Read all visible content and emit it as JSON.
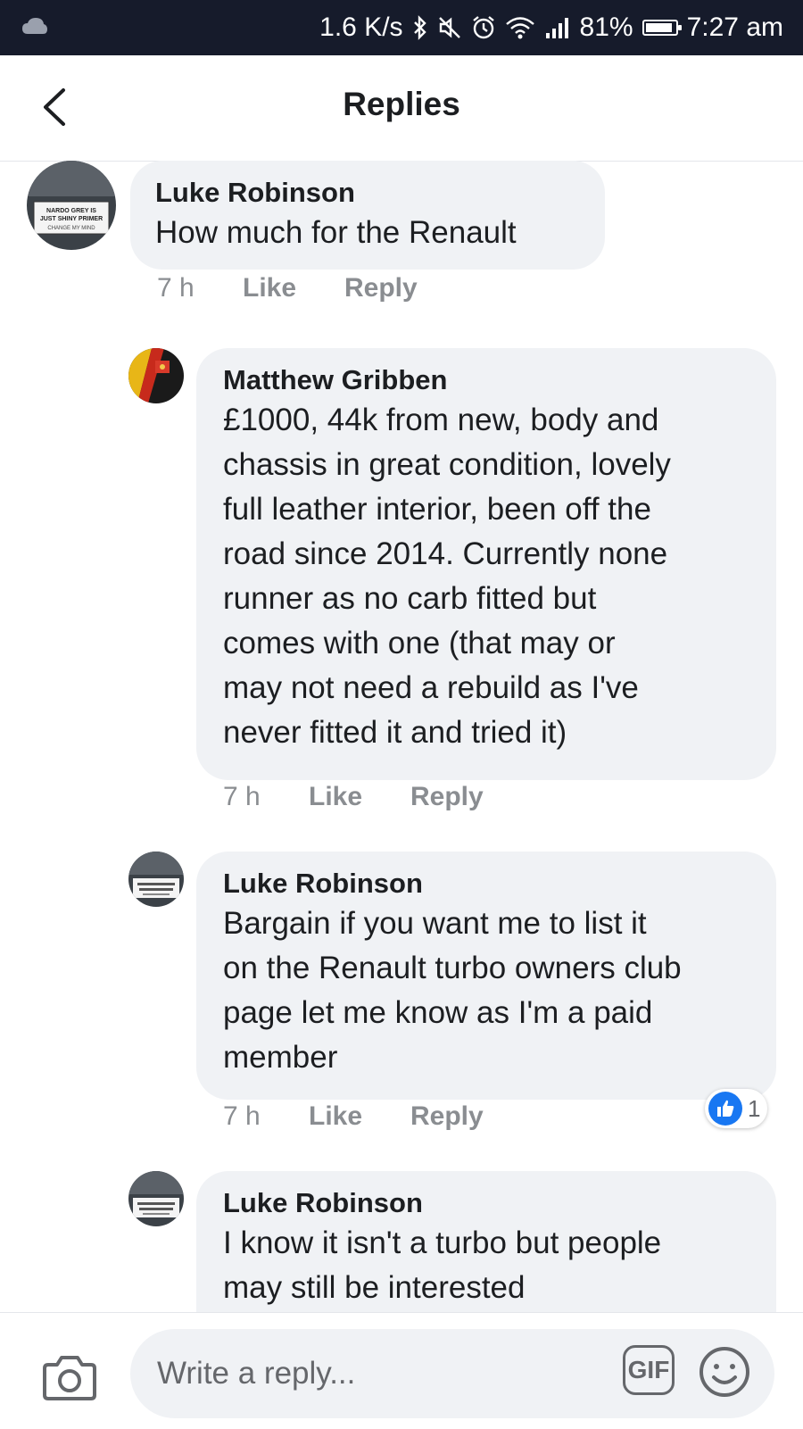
{
  "status_bar": {
    "speed": "1.6 K/s",
    "battery": "81%",
    "time": "7:27 am",
    "battery_level": 0.81
  },
  "header": {
    "title": "Replies"
  },
  "comments": [
    {
      "author": "Luke Robinson",
      "text": "How much for the Renault",
      "time": "7 h",
      "like_label": "Like",
      "reply_label": "Reply"
    },
    {
      "author": "Matthew Gribben",
      "text": "£1000, 44k from new, body and\nchassis in great condition, lovely\nfull leather interior, been off the\nroad since 2014. Currently none\nrunner as no carb fitted but\ncomes with one (that may or\nmay not need a rebuild as I've\nnever fitted it and tried it)",
      "time": "7 h",
      "like_label": "Like",
      "reply_label": "Reply"
    },
    {
      "author": "Luke Robinson",
      "text": "Bargain if you want me to list it\non the Renault turbo owners club\npage let me know as I'm a paid\nmember",
      "time": "7 h",
      "like_label": "Like",
      "reply_label": "Reply",
      "reaction_count": "1"
    },
    {
      "author": "Luke Robinson",
      "text": "I know it isn't a turbo but people\nmay still be interested"
    }
  ],
  "avatar_sign": {
    "line1": "NARDO GREY IS",
    "line2": "JUST SHINY PRIMER",
    "line3": "CHANGE MY MIND"
  },
  "composer": {
    "placeholder": "Write a reply...",
    "gif_label": "GIF"
  },
  "colors": {
    "status_bar_bg": "#161b2b",
    "bubble_bg": "#f0f2f5",
    "like_blue": "#1877f2",
    "meta_gray": "#8a8d91"
  }
}
